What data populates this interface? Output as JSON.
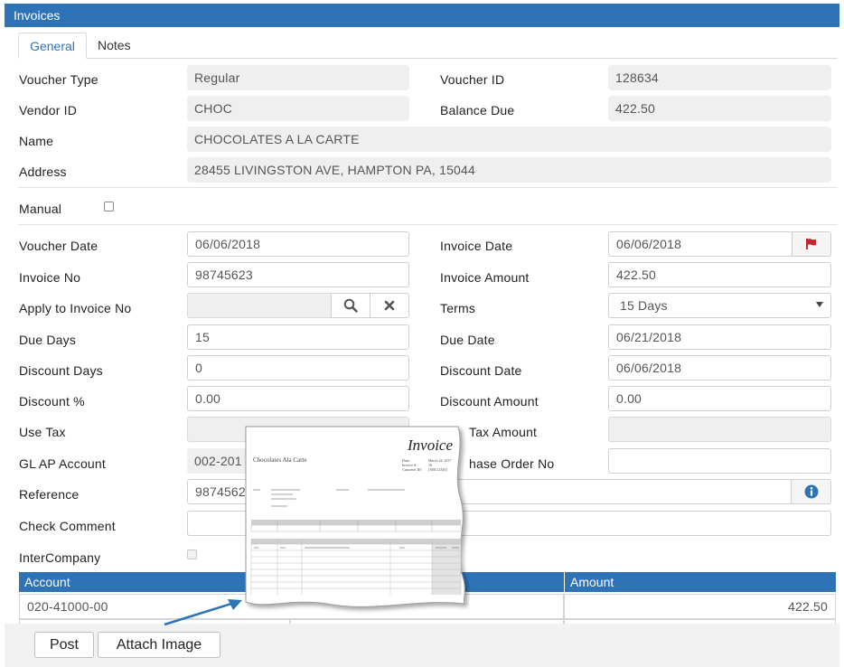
{
  "window": {
    "title": "Invoices"
  },
  "tabs": [
    {
      "label": "General",
      "active": true
    },
    {
      "label": "Notes",
      "active": false
    }
  ],
  "header_fields": {
    "voucher_type": {
      "label": "Voucher Type",
      "value": "Regular"
    },
    "voucher_id": {
      "label": "Voucher ID",
      "value": "128634"
    },
    "vendor_id": {
      "label": "Vendor ID",
      "value": "CHOC"
    },
    "balance_due": {
      "label": "Balance Due",
      "value": "422.50"
    },
    "name": {
      "label": "Name",
      "value": "CHOCOLATES A LA CARTE"
    },
    "address": {
      "label": "Address",
      "value": "28455 LIVINGSTON AVE, HAMPTON PA, 15044"
    }
  },
  "manual": {
    "label": "Manual",
    "checked": false
  },
  "form": {
    "voucher_date": {
      "label": "Voucher Date",
      "value": "06/06/2018"
    },
    "invoice_date": {
      "label": "Invoice Date",
      "value": "06/06/2018"
    },
    "invoice_no": {
      "label": "Invoice No",
      "value": "98745623"
    },
    "invoice_amount": {
      "label": "Invoice Amount",
      "value": "422.50"
    },
    "apply_to_invoice_no": {
      "label": "Apply to Invoice No",
      "value": ""
    },
    "terms": {
      "label": "Terms",
      "value": "15 Days"
    },
    "due_days": {
      "label": "Due Days",
      "value": "15"
    },
    "due_date": {
      "label": "Due Date",
      "value": "06/21/2018"
    },
    "discount_days": {
      "label": "Discount Days",
      "value": "0"
    },
    "discount_date": {
      "label": "Discount Date",
      "value": "06/06/2018"
    },
    "discount_pct": {
      "label": "Discount %",
      "value": "0.00"
    },
    "discount_amount": {
      "label": "Discount Amount",
      "value": "0.00"
    },
    "use_tax": {
      "label": "Use Tax",
      "value": ""
    },
    "use_tax_amount": {
      "label": "Tax Amount",
      "value": ""
    },
    "gl_ap_account": {
      "label": "GL AP Account",
      "value": "002-201"
    },
    "purchase_order_no": {
      "label": "hase Order No",
      "value": ""
    },
    "reference": {
      "label": "Reference",
      "value": "9874562"
    },
    "check_comment": {
      "label": "Check Comment",
      "value": ""
    },
    "intercompany": {
      "label": "InterCompany",
      "checked": false
    }
  },
  "grid": {
    "headers": {
      "account": "Account",
      "amount": "Amount"
    },
    "rows": [
      {
        "account": "020-41000-00",
        "amount": "422.50"
      }
    ]
  },
  "footer": {
    "post_label": "Post",
    "attach_label": "Attach Image"
  },
  "invoice_image": {
    "title": "Invoice",
    "company": "Chocolates Ala Carte",
    "meta_labels": [
      "Date:",
      "Invoice #:",
      "Customer ID:"
    ],
    "meta_values": [
      "March 22, 2017",
      "1b",
      "[ABC12345]"
    ]
  },
  "colors": {
    "accent": "#2f73b7",
    "flag": "#c0282d",
    "info": "#2f73b7"
  }
}
